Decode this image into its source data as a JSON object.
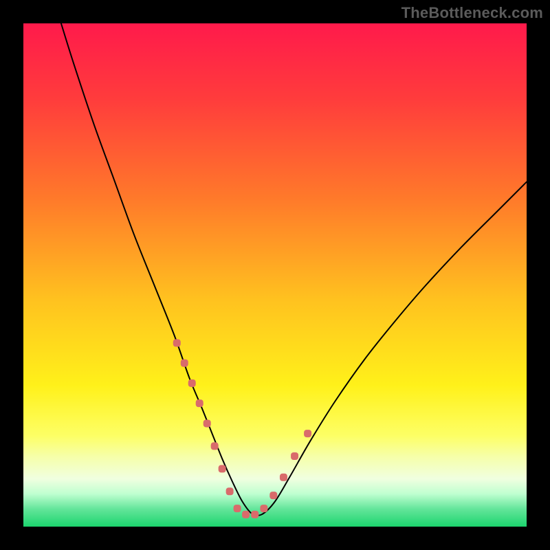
{
  "watermark": {
    "text": "TheBottleneck.com"
  },
  "chart_data": {
    "type": "line",
    "title": "",
    "xlabel": "",
    "ylabel": "",
    "xlim": [
      0,
      100
    ],
    "ylim": [
      0,
      100
    ],
    "grid": false,
    "legend": false,
    "gradient_stops": [
      {
        "offset": 0,
        "color": "#ff1a4b"
      },
      {
        "offset": 0.15,
        "color": "#ff3c3c"
      },
      {
        "offset": 0.35,
        "color": "#ff7a2a"
      },
      {
        "offset": 0.55,
        "color": "#ffc21f"
      },
      {
        "offset": 0.72,
        "color": "#fff11a"
      },
      {
        "offset": 0.82,
        "color": "#fdff66"
      },
      {
        "offset": 0.86,
        "color": "#f6ffa8"
      },
      {
        "offset": 0.905,
        "color": "#f0ffe0"
      },
      {
        "offset": 0.935,
        "color": "#bfffd0"
      },
      {
        "offset": 0.965,
        "color": "#63e59a"
      },
      {
        "offset": 1.0,
        "color": "#1cd46e"
      }
    ],
    "series": [
      {
        "name": "bottleneck-curve",
        "color": "#000000",
        "width": 2,
        "x": [
          7.5,
          10,
          14,
          18,
          22,
          26,
          30,
          33,
          35.5,
          37.5,
          39.5,
          41.5,
          43.5,
          45.5,
          47.5,
          50,
          53,
          57,
          62,
          68,
          74,
          80,
          87,
          94,
          100
        ],
        "y": [
          100,
          92,
          80,
          69,
          58,
          48,
          38,
          29.5,
          23.5,
          18.5,
          13.5,
          9,
          5,
          2.5,
          2.5,
          5,
          10,
          17,
          25,
          33.5,
          41,
          48,
          55.5,
          62.5,
          68.5
        ]
      }
    ],
    "markers": [
      {
        "name": "left-shoulder-markers",
        "color": "#d96b6b",
        "size": 11,
        "shape": "rounded-rect",
        "points": [
          {
            "x": 30.5,
            "y": 36.5
          },
          {
            "x": 32.0,
            "y": 32.5
          },
          {
            "x": 33.5,
            "y": 28.5
          },
          {
            "x": 35.0,
            "y": 24.5
          },
          {
            "x": 36.5,
            "y": 20.5
          },
          {
            "x": 38.0,
            "y": 16.0
          },
          {
            "x": 39.5,
            "y": 11.5
          },
          {
            "x": 41.0,
            "y": 7.0
          }
        ]
      },
      {
        "name": "valley-markers",
        "color": "#d96b6b",
        "size": 11,
        "shape": "rounded-rect",
        "points": [
          {
            "x": 42.5,
            "y": 3.6
          },
          {
            "x": 44.2,
            "y": 2.4
          },
          {
            "x": 46.0,
            "y": 2.4
          },
          {
            "x": 47.8,
            "y": 3.6
          }
        ]
      },
      {
        "name": "right-shoulder-markers",
        "color": "#d96b6b",
        "size": 11,
        "shape": "rounded-rect",
        "points": [
          {
            "x": 49.7,
            "y": 6.2
          },
          {
            "x": 51.7,
            "y": 9.8
          },
          {
            "x": 53.9,
            "y": 14.0
          },
          {
            "x": 56.5,
            "y": 18.5
          }
        ]
      }
    ]
  }
}
